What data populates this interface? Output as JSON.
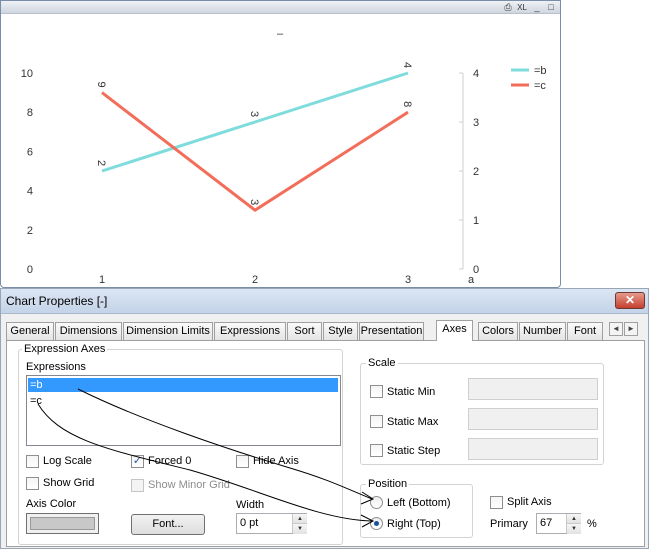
{
  "chart_window": {
    "caption_buttons": {
      "print": "⎙",
      "xl": "XL",
      "minimize": "_",
      "maximize": "□"
    },
    "chart_title": "–"
  },
  "chart_data": {
    "type": "line",
    "title": "–",
    "categories": [
      "1",
      "2",
      "3"
    ],
    "xlabel": "",
    "axis_title_right": "a",
    "left_axis": {
      "ticks": [
        "0",
        "2",
        "4",
        "6",
        "8",
        "10"
      ],
      "ylim": [
        0,
        10
      ]
    },
    "right_axis": {
      "ticks": [
        "0",
        "1",
        "2",
        "3",
        "4"
      ],
      "ylim": [
        0,
        4
      ]
    },
    "series": [
      {
        "name": "=b",
        "color": "#7fdcdc",
        "values": [
          2,
          3,
          4
        ],
        "data_labels": [
          "2",
          "3",
          "4"
        ],
        "axis": "right"
      },
      {
        "name": "=c",
        "color": "#f26e5a",
        "values": [
          9,
          3,
          8
        ],
        "data_labels": [
          "9",
          "3",
          "8"
        ],
        "axis": "left"
      }
    ],
    "legend": {
      "position": "top-right",
      "entries": [
        "=b",
        "=c"
      ]
    },
    "grid": false
  },
  "dialog": {
    "title": "Chart Properties [-]",
    "close_label": "✕",
    "tabs": [
      "General",
      "Dimensions",
      "Dimension Limits",
      "Expressions",
      "Sort",
      "Style",
      "Presentation",
      "Axes",
      "Colors",
      "Number",
      "Font"
    ],
    "active_tab": "Axes",
    "tab_scroll_left": "◄",
    "tab_scroll_right": "►",
    "expression_axes": {
      "group_label": "Expression Axes",
      "expressions_label": "Expressions",
      "expressions": [
        "=b",
        "=c"
      ],
      "selected_expression": "=b",
      "log_scale_label": "Log Scale",
      "log_scale_checked": false,
      "forced0_label": "Forced 0",
      "forced0_checked": true,
      "forced0_mark": "✓",
      "hide_axis_label": "Hide Axis",
      "hide_axis_checked": false,
      "show_grid_label": "Show Grid",
      "show_grid_checked": false,
      "show_minor_grid_label": "Show Minor Grid",
      "show_minor_grid_checked": false,
      "axis_color_label": "Axis Color",
      "font_button_label": "Font...",
      "width_label": "Width",
      "width_value": "0 pt",
      "spin_up": "▲",
      "spin_down": "▼"
    },
    "scale": {
      "group_label": "Scale",
      "static_min_label": "Static Min",
      "static_max_label": "Static Max",
      "static_step_label": "Static Step",
      "static_min_value": "",
      "static_max_value": "",
      "static_step_value": ""
    },
    "position": {
      "group_label": "Position",
      "left_bottom_label": "Left (Bottom)",
      "right_top_label": "Right (Top)",
      "selected": "Right (Top)"
    },
    "split_axis": {
      "label": "Split Axis",
      "checked": false,
      "primary_label": "Primary",
      "primary_value": "67",
      "percent_label": "%"
    }
  }
}
